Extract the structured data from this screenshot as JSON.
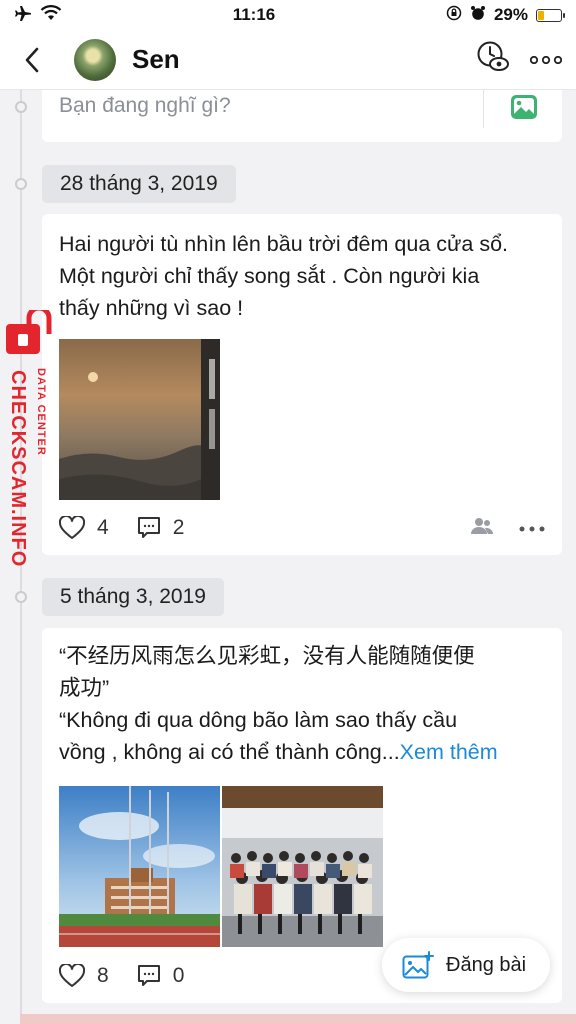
{
  "status": {
    "time": "11:16",
    "battery": "29%",
    "battery_level": 0.29
  },
  "header": {
    "title": "Sen"
  },
  "composer": {
    "placeholder": "Bạn đang nghĩ gì?"
  },
  "posts": [
    {
      "date": "28 tháng 3, 2019",
      "text_lines": [
        "Hai người tù nhìn lên bầu trời đêm qua cửa sổ.",
        "Một người chỉ thấy song sắt . Còn người kia",
        "thấy những vì sao !"
      ],
      "likes": "4",
      "comments": "2"
    },
    {
      "date": "5 tháng 3, 2019",
      "text_lines": [
        "“不经历风雨怎么见彩虹，没有人能随随便便",
        "成功”",
        "“Không đi qua dông bão làm sao thấy cầu",
        "vồng , không ai có thể thành công..."
      ],
      "see_more": "Xem thêm",
      "likes": "8",
      "comments": "0"
    }
  ],
  "fab": {
    "label": "Đăng bài"
  },
  "watermark": {
    "brand": "CHECKSCAM.INFO",
    "sub": "DATA CENTER"
  },
  "colors": {
    "link": "#1a8ad9",
    "accent_green": "#3cb371",
    "watermark_red": "#e3262e"
  }
}
